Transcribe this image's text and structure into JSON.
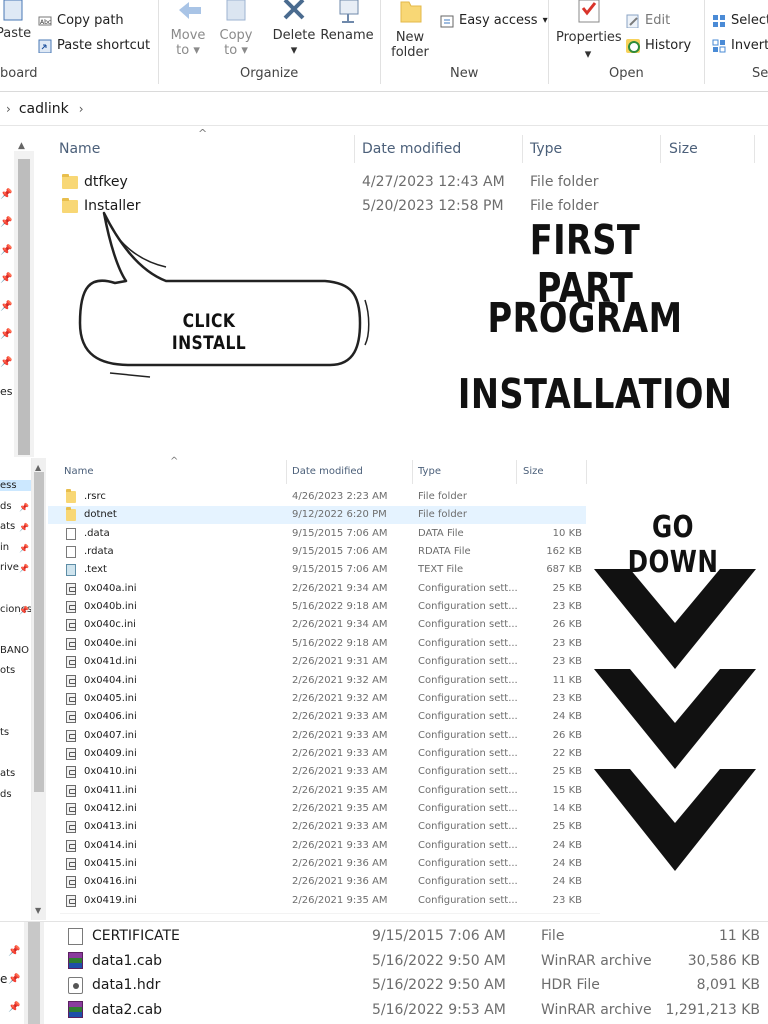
{
  "ribbon": {
    "paste_label": "Paste",
    "copy_path_label": "Copy path",
    "paste_shortcut_label": "Paste shortcut",
    "clipboard_group": "board",
    "move_to_label": "Move",
    "move_to_sub": "to",
    "copy_to_label": "Copy",
    "copy_to_sub": "to",
    "delete_label": "Delete",
    "rename_label": "Rename",
    "organize_group": "Organize",
    "new_folder_label": "New",
    "new_folder_sub": "folder",
    "easy_access_label": "Easy access",
    "new_group": "New",
    "properties_label": "Properties",
    "edit_label": "Edit",
    "history_label": "History",
    "open_group": "Open",
    "select_label": "Select",
    "invert_label": "Invert",
    "select_group": "Se"
  },
  "address": {
    "crumb": "cadlink"
  },
  "panel1": {
    "columns": [
      "Name",
      "Date modified",
      "Type",
      "Size"
    ],
    "rows": [
      {
        "name": "dtfkey",
        "date": "4/27/2023 12:43 AM",
        "type": "File folder",
        "size": ""
      },
      {
        "name": "Installer",
        "date": "5/20/2023 12:58 PM",
        "type": "File folder",
        "size": ""
      }
    ],
    "nav_tail": "es"
  },
  "annotations": {
    "bubble_text": "CLICK INSTALL",
    "title_line1": "FIRST PART",
    "title_line2": "PROGRAM",
    "title_line3": "INSTALLATION",
    "go_down": "GO DOWN"
  },
  "panel2": {
    "columns": [
      "Name",
      "Date modified",
      "Type",
      "Size"
    ],
    "nav_items": [
      "ess",
      "ds",
      "ats",
      "in",
      "rive",
      "",
      "ciones",
      "",
      "BANO",
      "ots",
      "",
      "",
      "ts",
      "",
      "ats",
      "ds"
    ],
    "rows": [
      {
        "icon": "folder",
        "name": ".rsrc",
        "date": "4/26/2023 2:23 AM",
        "type": "File folder",
        "size": ""
      },
      {
        "icon": "folder",
        "name": "dotnet",
        "date": "9/12/2022 6:20 PM",
        "type": "File folder",
        "size": "",
        "selected": true
      },
      {
        "icon": "doc",
        "name": ".data",
        "date": "9/15/2015 7:06 AM",
        "type": "DATA File",
        "size": "10 KB"
      },
      {
        "icon": "doc",
        "name": ".rdata",
        "date": "9/15/2015 7:06 AM",
        "type": "RDATA File",
        "size": "162 KB"
      },
      {
        "icon": "txt",
        "name": ".text",
        "date": "9/15/2015 7:06 AM",
        "type": "TEXT File",
        "size": "687 KB"
      },
      {
        "icon": "cfg",
        "name": "0x040a.ini",
        "date": "2/26/2021 9:34 AM",
        "type": "Configuration sett...",
        "size": "25 KB"
      },
      {
        "icon": "cfg",
        "name": "0x040b.ini",
        "date": "5/16/2022 9:18 AM",
        "type": "Configuration sett...",
        "size": "23 KB"
      },
      {
        "icon": "cfg",
        "name": "0x040c.ini",
        "date": "2/26/2021 9:34 AM",
        "type": "Configuration sett...",
        "size": "26 KB"
      },
      {
        "icon": "cfg",
        "name": "0x040e.ini",
        "date": "5/16/2022 9:18 AM",
        "type": "Configuration sett...",
        "size": "23 KB"
      },
      {
        "icon": "cfg",
        "name": "0x041d.ini",
        "date": "2/26/2021 9:31 AM",
        "type": "Configuration sett...",
        "size": "23 KB"
      },
      {
        "icon": "cfg",
        "name": "0x0404.ini",
        "date": "2/26/2021 9:32 AM",
        "type": "Configuration sett...",
        "size": "11 KB"
      },
      {
        "icon": "cfg",
        "name": "0x0405.ini",
        "date": "2/26/2021 9:32 AM",
        "type": "Configuration sett...",
        "size": "23 KB"
      },
      {
        "icon": "cfg",
        "name": "0x0406.ini",
        "date": "2/26/2021 9:33 AM",
        "type": "Configuration sett...",
        "size": "24 KB"
      },
      {
        "icon": "cfg",
        "name": "0x0407.ini",
        "date": "2/26/2021 9:33 AM",
        "type": "Configuration sett...",
        "size": "26 KB"
      },
      {
        "icon": "cfg",
        "name": "0x0409.ini",
        "date": "2/26/2021 9:33 AM",
        "type": "Configuration sett...",
        "size": "22 KB"
      },
      {
        "icon": "cfg",
        "name": "0x0410.ini",
        "date": "2/26/2021 9:33 AM",
        "type": "Configuration sett...",
        "size": "25 KB"
      },
      {
        "icon": "cfg",
        "name": "0x0411.ini",
        "date": "2/26/2021 9:35 AM",
        "type": "Configuration sett...",
        "size": "15 KB"
      },
      {
        "icon": "cfg",
        "name": "0x0412.ini",
        "date": "2/26/2021 9:35 AM",
        "type": "Configuration sett...",
        "size": "14 KB"
      },
      {
        "icon": "cfg",
        "name": "0x0413.ini",
        "date": "2/26/2021 9:33 AM",
        "type": "Configuration sett...",
        "size": "25 KB"
      },
      {
        "icon": "cfg",
        "name": "0x0414.ini",
        "date": "2/26/2021 9:33 AM",
        "type": "Configuration sett...",
        "size": "24 KB"
      },
      {
        "icon": "cfg",
        "name": "0x0415.ini",
        "date": "2/26/2021 9:36 AM",
        "type": "Configuration sett...",
        "size": "24 KB"
      },
      {
        "icon": "cfg",
        "name": "0x0416.ini",
        "date": "2/26/2021 9:36 AM",
        "type": "Configuration sett...",
        "size": "24 KB"
      },
      {
        "icon": "cfg",
        "name": "0x0419.ini",
        "date": "2/26/2021 9:35 AM",
        "type": "Configuration sett...",
        "size": "23 KB"
      }
    ]
  },
  "panel3": {
    "rows": [
      {
        "icon": "doc",
        "name": "CERTIFICATE",
        "date": "9/15/2015 7:06 AM",
        "type": "File",
        "size": "11 KB"
      },
      {
        "icon": "rar",
        "name": "data1.cab",
        "date": "5/16/2022 9:50 AM",
        "type": "WinRAR archive",
        "size": "30,586 KB"
      },
      {
        "icon": "hdr",
        "name": "data1.hdr",
        "date": "5/16/2022 9:50 AM",
        "type": "HDR File",
        "size": "8,091 KB"
      },
      {
        "icon": "rar",
        "name": "data2.cab",
        "date": "5/16/2022 9:53 AM",
        "type": "WinRAR archive",
        "size": "1,291,213 KB"
      }
    ],
    "nav_tail": "e"
  }
}
